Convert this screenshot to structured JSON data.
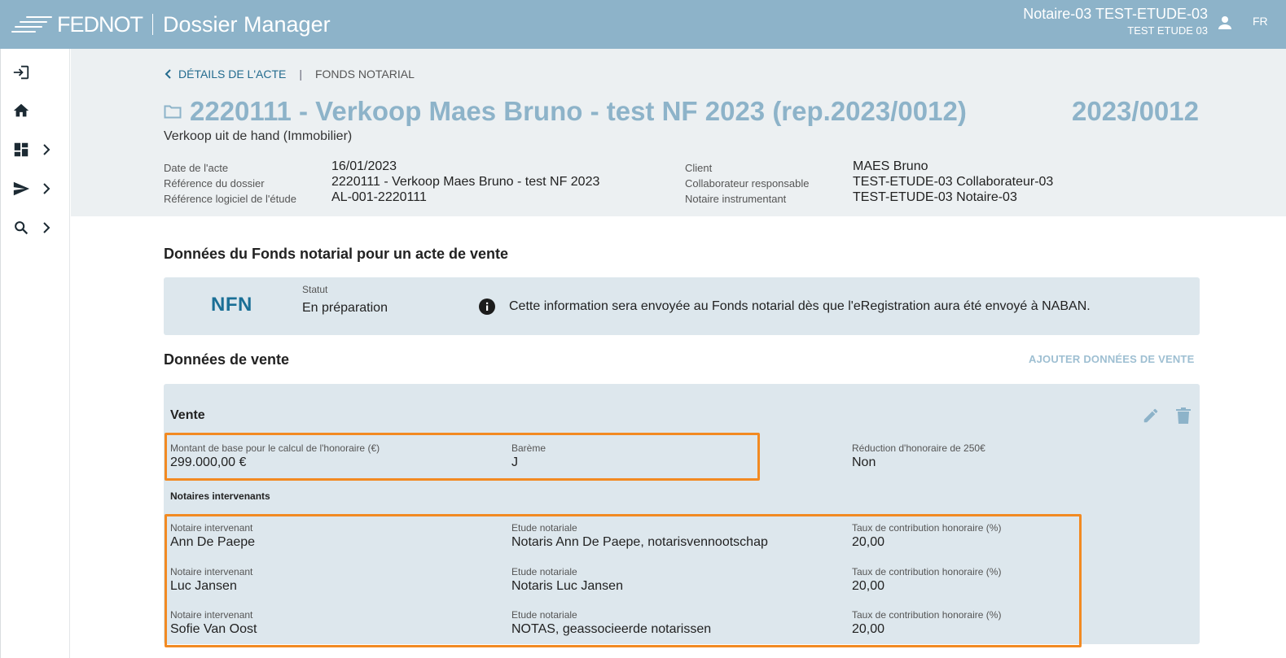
{
  "header": {
    "brand": "FEDNOT",
    "app_name": "Dossier Manager",
    "user_name": "Notaire-03 TEST-ETUDE-03",
    "user_etude": "TEST ETUDE 03",
    "user_icon": "person-icon",
    "language": "FR"
  },
  "sidebar": {
    "items": [
      {
        "icon": "login-icon",
        "has_submenu": false
      },
      {
        "icon": "home-icon",
        "has_submenu": false
      },
      {
        "icon": "dashboard-icon",
        "has_submenu": true
      },
      {
        "icon": "send-icon",
        "has_submenu": true
      },
      {
        "icon": "search-icon",
        "has_submenu": true
      }
    ]
  },
  "breadcrumb": {
    "back_label": "DÉTAILS DE L'ACTE",
    "separator": "|",
    "current": "FONDS NOTARIAL"
  },
  "act": {
    "title": "2220111 - Verkoop Maes Bruno - test NF 2023 (rep.2023/0012)",
    "rep_number": "2023/0012",
    "subtitle": "Verkoop uit de hand (Immobilier)",
    "meta_left": [
      {
        "label": "Date de l'acte",
        "value": "16/01/2023"
      },
      {
        "label": "Référence du dossier",
        "value": "2220111 - Verkoop Maes Bruno - test NF 2023"
      },
      {
        "label": "Référence logiciel de l'étude",
        "value": "AL-001-2220111"
      }
    ],
    "meta_right": [
      {
        "label": "Client",
        "value": "MAES Bruno"
      },
      {
        "label": "Collaborateur responsable",
        "value": "TEST-ETUDE-03 Collaborateur-03"
      },
      {
        "label": "Notaire instrumentant",
        "value": "TEST-ETUDE-03 Notaire-03"
      }
    ]
  },
  "fonds": {
    "section_title": "Données du Fonds notarial pour un acte de vente",
    "logo": "NFN",
    "statut_label": "Statut",
    "statut_value": "En préparation",
    "info_text": "Cette information sera envoyée au Fonds notarial dès que l'eRegistration aura été envoyé à NABAN."
  },
  "vente_data": {
    "section_title": "Données de vente",
    "add_label": "AJOUTER DONNÉES DE VENTE",
    "card_title": "Vente",
    "base_amount_label": "Montant de base pour le calcul de l'honoraire (€)",
    "base_amount_value": "299.000,00 €",
    "bareme_label": "Barème",
    "bareme_value": "J",
    "reduction_label": "Réduction d'honoraire de 250€",
    "reduction_value": "Non",
    "notaires_title": "Notaires intervenants",
    "notaires": [
      {
        "notaire_label": "Notaire intervenant",
        "notaire": "Ann De Paepe",
        "etude_label": "Etude notariale",
        "etude": "Notaris Ann De Paepe, notarisvennootschap",
        "taux_label": "Taux de contribution honoraire (%)",
        "taux": "20,00"
      },
      {
        "notaire_label": "Notaire intervenant",
        "notaire": "Luc Jansen",
        "etude_label": "Etude notariale",
        "etude": "Notaris Luc Jansen",
        "taux_label": "Taux de contribution honoraire (%)",
        "taux": "20,00"
      },
      {
        "notaire_label": "Notaire intervenant",
        "notaire": "Sofie Van Oost",
        "etude_label": "Etude notariale",
        "etude": "NOTAS, geassocieerde notarissen",
        "taux_label": "Taux de contribution honoraire (%)",
        "taux": "20,00"
      }
    ]
  },
  "colors": {
    "header_bg": "#8db3c9",
    "info_bg": "#ecf0f2",
    "panel_bg": "#dde7ed",
    "accent_blue": "#236b8e",
    "highlight_orange": "#f28a22"
  }
}
